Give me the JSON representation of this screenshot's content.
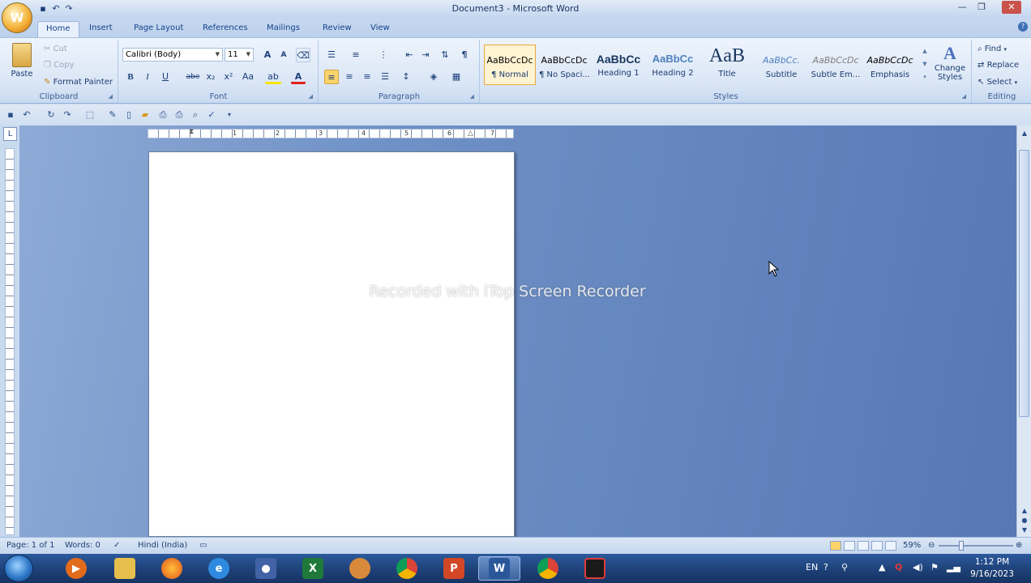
{
  "window": {
    "title": "Document3 - Microsoft Word"
  },
  "office_button": {
    "letter": "W"
  },
  "tabs": [
    "Home",
    "Insert",
    "Page Layout",
    "References",
    "Mailings",
    "Review",
    "View"
  ],
  "clipboard": {
    "paste": "Paste",
    "cut": "Cut",
    "copy": "Copy",
    "format_painter": "Format Painter",
    "label": "Clipboard"
  },
  "font": {
    "name": "Calibri (Body)",
    "size": "11",
    "label": "Font",
    "bold": "B",
    "italic": "I",
    "underline": "U",
    "strike": "abe",
    "sub": "x₂",
    "sup": "x²",
    "case": "Aa",
    "grow": "A",
    "shrink": "A",
    "highlight": "ab",
    "color": "A"
  },
  "paragraph": {
    "label": "Paragraph",
    "pilcrow": "¶"
  },
  "styles": {
    "label": "Styles",
    "items": [
      {
        "preview": "AaBbCcDc",
        "name": "¶ Normal"
      },
      {
        "preview": "AaBbCcDc",
        "name": "¶ No Spaci..."
      },
      {
        "preview": "AaBbCc",
        "name": "Heading 1"
      },
      {
        "preview": "AaBbCc",
        "name": "Heading 2"
      },
      {
        "preview": "AaB",
        "name": "Title"
      },
      {
        "preview": "AaBbCc.",
        "name": "Subtitle"
      },
      {
        "preview": "AaBbCcDc",
        "name": "Subtle Em..."
      },
      {
        "preview": "AaBbCcDc",
        "name": "Emphasis"
      }
    ],
    "change_styles": "Change Styles"
  },
  "editing": {
    "find": "Find",
    "replace": "Replace",
    "select": "Select",
    "label": "Editing"
  },
  "ruler_numbers": [
    "1",
    "2",
    "3",
    "4",
    "5",
    "6",
    "7"
  ],
  "watermark": "Recorded with iTop Screen Recorder",
  "status": {
    "page": "Page: 1 of 1",
    "words": "Words: 0",
    "language": "Hindi (India)",
    "zoom": "59%"
  },
  "tray": {
    "lang": "EN",
    "time": "1:12 PM",
    "date": "9/16/2023"
  },
  "colors": {
    "accent": "#15428b",
    "ribbon": "#dae6f6",
    "taskbar": "#1d3f75",
    "doc_bg": "#6f91c6"
  }
}
